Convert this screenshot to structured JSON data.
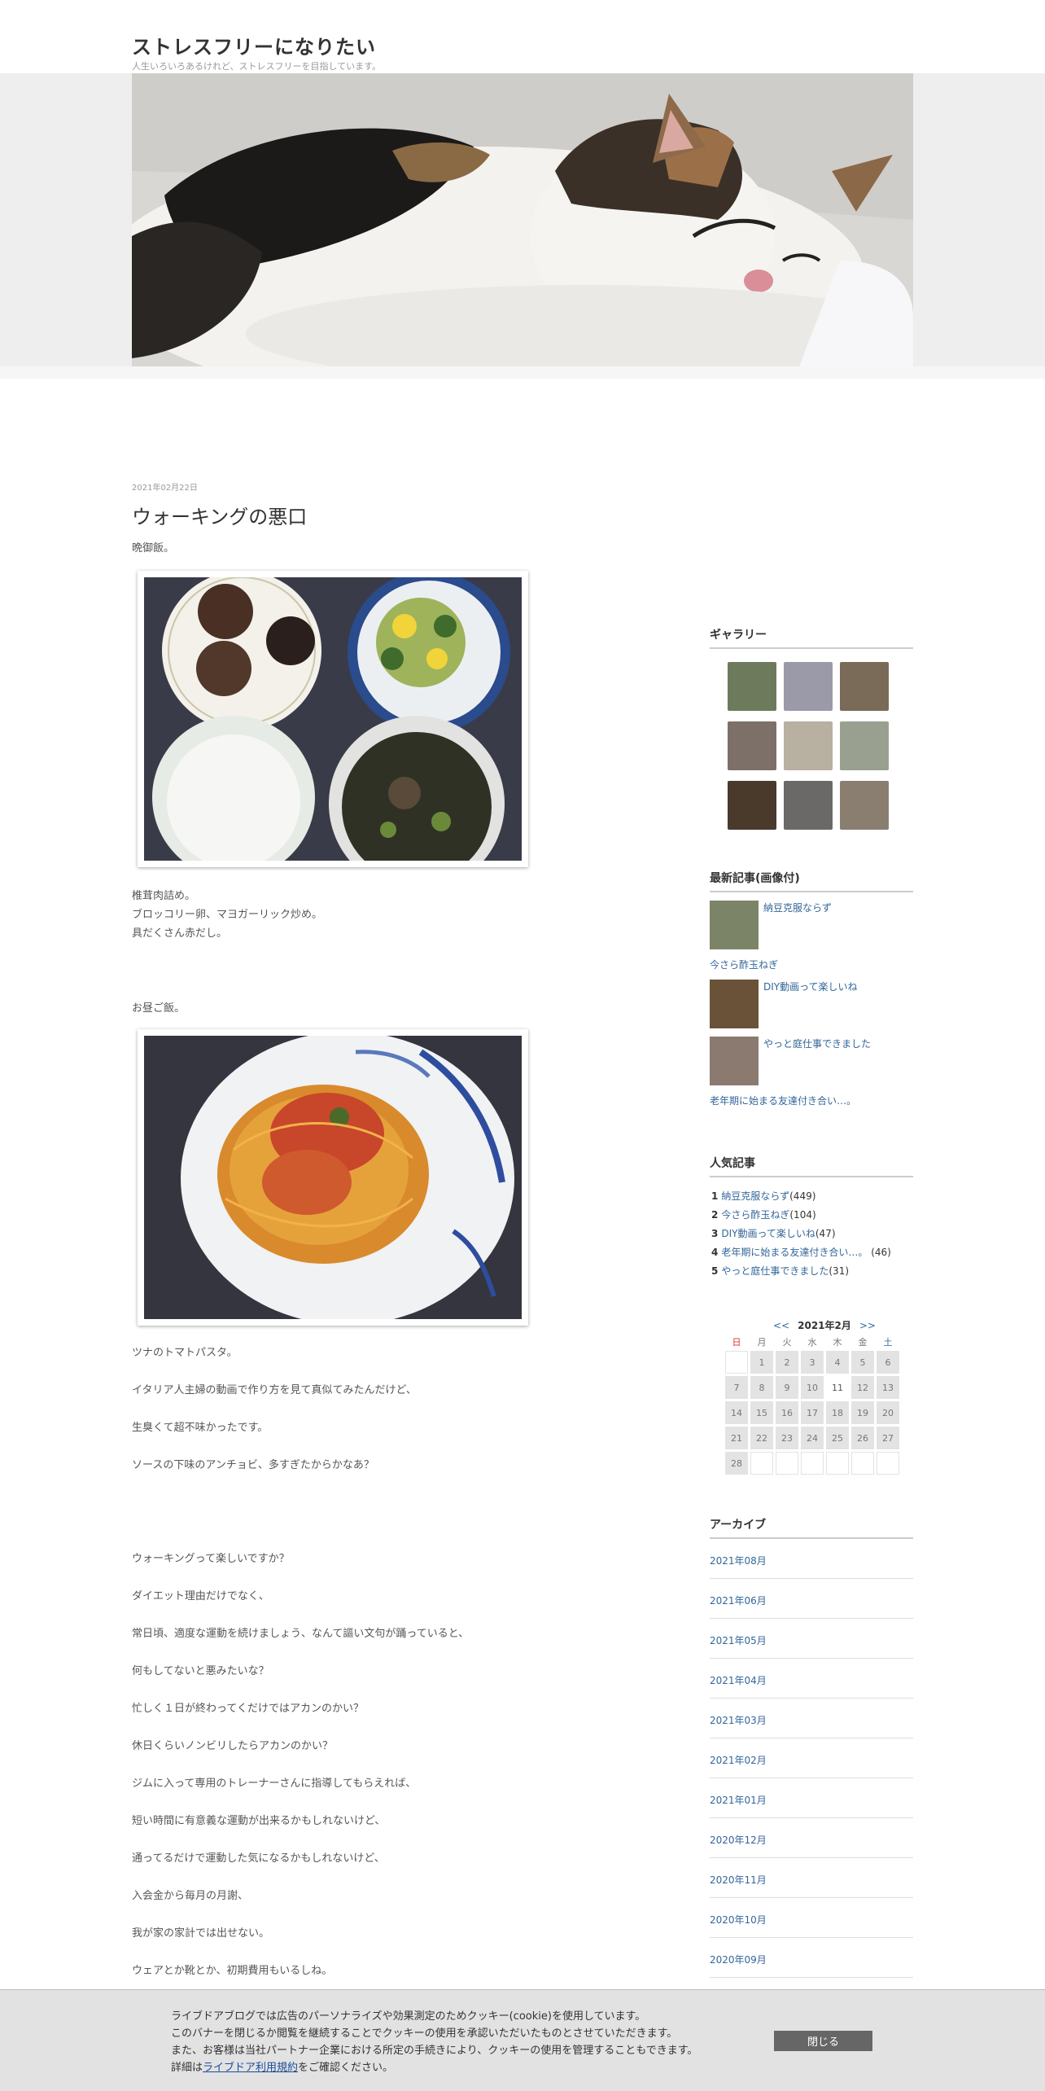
{
  "header": {
    "title": "ストレスフリーになりたい",
    "description": "人生いろいろあるけれど、ストレスフリーを目指しています。"
  },
  "post": {
    "date": "2021年02月22日",
    "title": "ウォーキングの悪口",
    "intro": "晩御飯。",
    "dinner_lines": [
      "椎茸肉詰め。",
      "ブロッコリー卵、マヨガーリック炒め。",
      "具だくさん赤だし。"
    ],
    "lunch_label": "お昼ご飯。",
    "pasta_caption": "ツナのトマトパスタ。",
    "paragraphs": [
      "イタリア人主婦の動画で作り方を見て真似てみたんだけど、",
      "生臭くて超不味かったです。",
      "ソースの下味のアンチョビ、多すぎたからかなあ？"
    ],
    "walking_paragraphs": [
      "ウォーキングって楽しいですか？",
      "ダイエット理由だけでなく、",
      "常日頃、適度な運動を続けましょう、なんて謳い文句が踊っていると、",
      "何もしてないと悪みたいな？",
      "忙しく１日が終わってくだけではアカンのかい？",
      "休日くらいノンビリしたらアカンのかい？",
      "ジムに入って専用のトレーナーさんに指導してもらえれば、",
      "短い時間に有意義な運動が出来るかもしれないけど、",
      "通ってるだけで運動した気になるかもしれないけど、",
      "入会金から毎月の月謝、",
      "我が家の家計では出せない。",
      "ウェアとか靴とか、初期費用もいるしね。"
    ]
  },
  "sidebar": {
    "gallery_title": "ギャラリー",
    "gallery_colors": [
      "#6e7a5c",
      "#9a9aa8",
      "#7a6a58",
      "#7d7068",
      "#b8b0a0",
      "#9aa090",
      "#4a3a2c",
      "#6b6868",
      "#8a7e70"
    ],
    "recent_title": "最新記事(画像付)",
    "recent": [
      {
        "label": "納豆克服ならず",
        "has_image": true,
        "color": "#7c8468"
      },
      {
        "label": "今さら酢玉ねぎ",
        "has_image": false
      },
      {
        "label": "DIY動画って楽しいね",
        "has_image": true,
        "color": "#6a5238"
      },
      {
        "label": "やっと庭仕事できました",
        "has_image": true,
        "color": "#8a7a70"
      },
      {
        "label": "老年期に始まる友達付き合い…。",
        "has_image": false
      }
    ],
    "popular_title": "人気記事",
    "popular": [
      {
        "rank": "1",
        "label": "納豆克服ならず",
        "count": "(449)"
      },
      {
        "rank": "2",
        "label": "今さら酢玉ねぎ",
        "count": "(104)"
      },
      {
        "rank": "3",
        "label": "DIY動画って楽しいね",
        "count": "(47)"
      },
      {
        "rank": "4",
        "label": "老年期に始まる友達付き合い…。",
        "count": " (46)"
      },
      {
        "rank": "5",
        "label": "やっと庭仕事できました",
        "count": "(31)"
      }
    ],
    "calendar": {
      "prev": "<<",
      "month": "2021年2月",
      "next": ">>",
      "weekdays": [
        "日",
        "月",
        "火",
        "水",
        "木",
        "金",
        "土"
      ],
      "today": "11",
      "weeks": [
        [
          "",
          "1",
          "2",
          "3",
          "4",
          "5",
          "6"
        ],
        [
          "7",
          "8",
          "9",
          "10",
          "11",
          "12",
          "13"
        ],
        [
          "14",
          "15",
          "16",
          "17",
          "18",
          "19",
          "20"
        ],
        [
          "21",
          "22",
          "23",
          "24",
          "25",
          "26",
          "27"
        ],
        [
          "28",
          "",
          "",
          "",
          "",
          "",
          ""
        ]
      ]
    },
    "archive_title": "アーカイブ",
    "archives": [
      "2021年08月",
      "2021年06月",
      "2021年05月",
      "2021年04月",
      "2021年03月",
      "2021年02月",
      "2021年01月",
      "2020年12月",
      "2020年11月",
      "2020年10月",
      "2020年09月"
    ]
  },
  "cookie": {
    "line1": "ライブドアブログでは広告のパーソナライズや効果測定のためクッキー(cookie)を使用しています。",
    "line2": "このバナーを閉じるか閲覧を継続することでクッキーの使用を承認いただいたものとさせていただきます。",
    "line3": "また、お客様は当社パートナー企業における所定の手続きにより、クッキーの使用を管理することもできます。",
    "line4_prefix": "詳細は",
    "line4_link": "ライブドア利用規約",
    "line4_suffix": "をご確認ください。",
    "close": "閉じる"
  }
}
